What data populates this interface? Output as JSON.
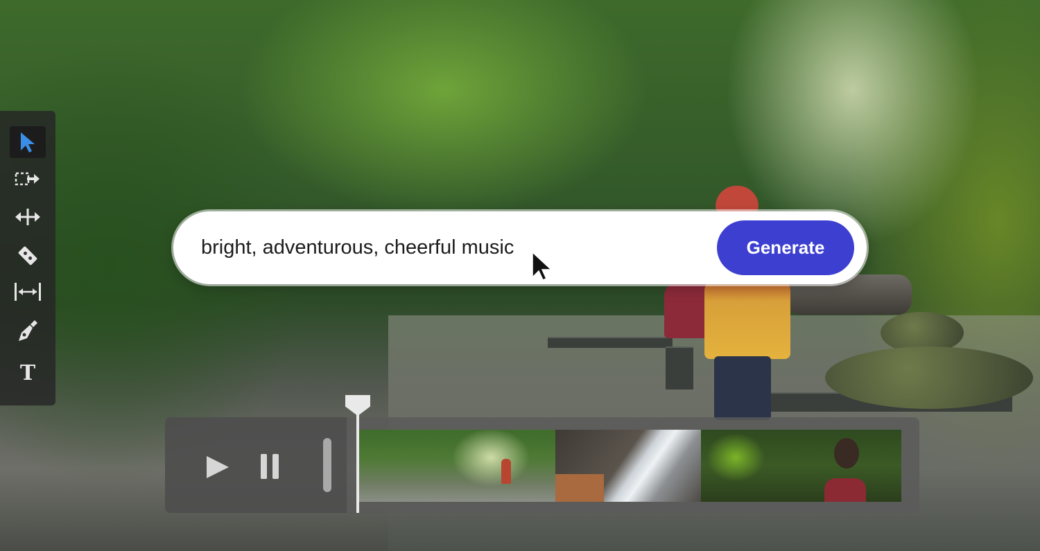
{
  "prompt": {
    "text": "bright, adventurous, cheerful music",
    "generate_label": "Generate"
  },
  "toolbar": {
    "tools": [
      {
        "name": "selection-tool",
        "icon": "arrow-pointer-icon",
        "active": true
      },
      {
        "name": "track-select-forward-tool",
        "icon": "track-select-forward-icon"
      },
      {
        "name": "ripple-edit-tool",
        "icon": "ripple-edit-icon"
      },
      {
        "name": "razor-tool",
        "icon": "razor-icon"
      },
      {
        "name": "slip-tool",
        "icon": "slip-icon"
      },
      {
        "name": "pen-tool",
        "icon": "pen-nib-icon"
      },
      {
        "name": "type-tool",
        "icon": "type-icon",
        "glyph": "T"
      }
    ]
  },
  "player": {
    "controls": [
      "play-icon",
      "pause-icon"
    ]
  },
  "colors": {
    "generate_button": "#3d3fd1",
    "prompt_background": "#ffffff",
    "tool_active": "#3b8ee8"
  }
}
